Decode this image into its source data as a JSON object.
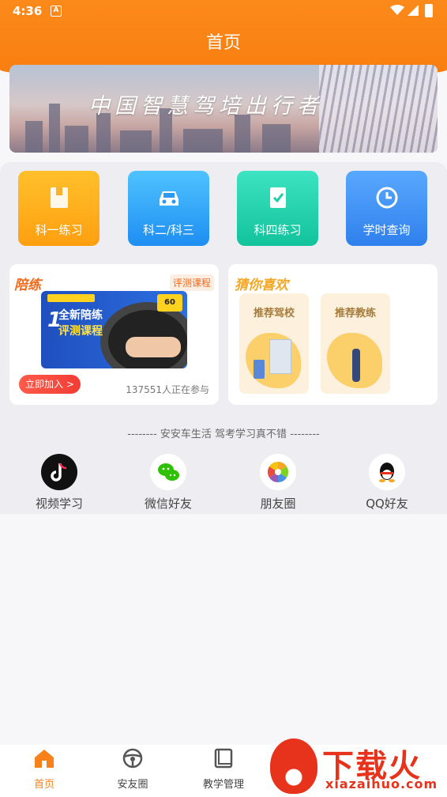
{
  "status_bar": {
    "time": "4:36",
    "notification_icon": "A"
  },
  "header": {
    "title": "首页"
  },
  "banner": {
    "slogan": "中国智慧驾培出行者"
  },
  "quick_tiles": [
    {
      "label": "科一练习",
      "icon": "book-icon",
      "color": "#ffa81a"
    },
    {
      "label": "科二/科三",
      "icon": "car-icon",
      "color": "#2b9af5"
    },
    {
      "label": "科四练习",
      "icon": "checklist-icon",
      "color": "#1ccfa8"
    },
    {
      "label": "学时查询",
      "icon": "clock-icon",
      "color": "#3b8df0"
    }
  ],
  "practice_card": {
    "title": "陪练",
    "tag": "评测课程",
    "promo_big": "1",
    "promo_head": "全新陪练",
    "promo_sub": "评测课程",
    "promo_price": "60",
    "join_label": "立即加入 >",
    "participants": "137551人正在参与"
  },
  "recommend_card": {
    "title": "猜你喜欢",
    "items": [
      {
        "label": "推荐驾校"
      },
      {
        "label": "推荐教练"
      }
    ]
  },
  "share": {
    "slogan": "-------- 安安车生活  驾考学习真不错 --------",
    "items": [
      {
        "label": "视频学习",
        "icon": "tiktok-icon"
      },
      {
        "label": "微信好友",
        "icon": "wechat-icon"
      },
      {
        "label": "朋友圈",
        "icon": "moments-icon"
      },
      {
        "label": "QQ好友",
        "icon": "qq-icon"
      }
    ]
  },
  "bottom_nav": {
    "items": [
      {
        "label": "首页",
        "icon": "home-icon",
        "active": true
      },
      {
        "label": "安友圈",
        "icon": "steering-wheel-icon",
        "active": false
      },
      {
        "label": "教学管理",
        "icon": "book-icon",
        "active": false
      }
    ]
  },
  "watermark": {
    "text": "下载火",
    "url": "xiazaihuo.com"
  },
  "colors": {
    "accent": "#f7821b",
    "header": "#fb8a1a"
  }
}
